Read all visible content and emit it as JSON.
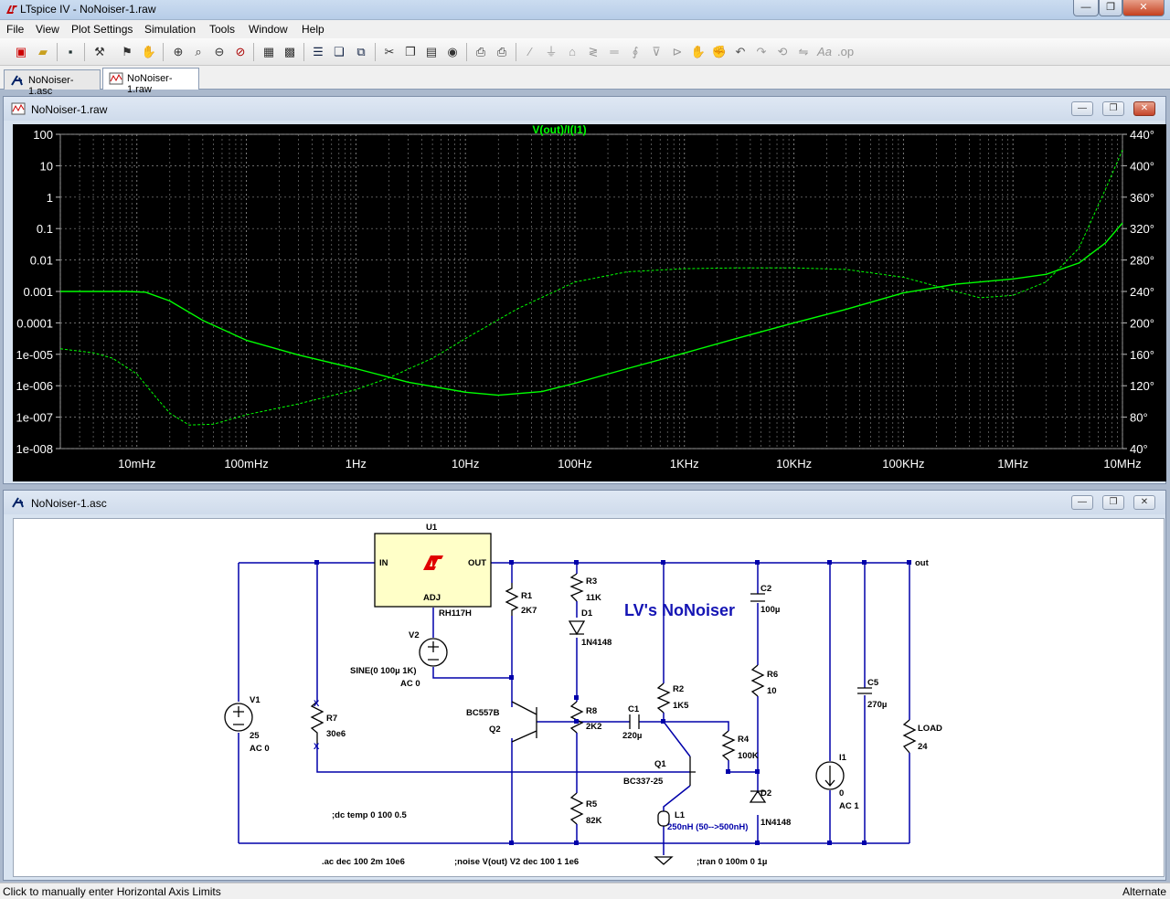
{
  "window": {
    "title": "LTspice IV - NoNoiser-1.raw"
  },
  "menu": [
    "File",
    "View",
    "Plot Settings",
    "Simulation",
    "Tools",
    "Window",
    "Help"
  ],
  "tabs": [
    {
      "label": "NoNoiser-1.asc"
    },
    {
      "label": "NoNoiser-1.raw"
    }
  ],
  "plot_window": {
    "title": "NoNoiser-1.raw",
    "trace_label": "V(out)/I(I1)",
    "colors": {
      "background": "#000000",
      "trace": "#00ff00",
      "axis_text": "#ffffff"
    }
  },
  "chart_data": {
    "type": "line",
    "title": "V(out)/I(I1)",
    "x_scale": "log",
    "xlim": [
      0.002,
      10000000
    ],
    "x_ticks": [
      {
        "v": 0.01,
        "label": "10mHz"
      },
      {
        "v": 0.1,
        "label": "100mHz"
      },
      {
        "v": 1,
        "label": "1Hz"
      },
      {
        "v": 10,
        "label": "10Hz"
      },
      {
        "v": 100,
        "label": "100Hz"
      },
      {
        "v": 1000,
        "label": "1KHz"
      },
      {
        "v": 10000,
        "label": "10KHz"
      },
      {
        "v": 100000,
        "label": "100KHz"
      },
      {
        "v": 1000000,
        "label": "1MHz"
      },
      {
        "v": 10000000,
        "label": "10MHz"
      }
    ],
    "y_scale": "log",
    "ylim": [
      1e-08,
      100
    ],
    "y_ticks": [
      {
        "v": 100,
        "label": "100"
      },
      {
        "v": 10,
        "label": "10"
      },
      {
        "v": 1,
        "label": "1"
      },
      {
        "v": 0.1,
        "label": "0.1"
      },
      {
        "v": 0.01,
        "label": "0.01"
      },
      {
        "v": 0.001,
        "label": "0.001"
      },
      {
        "v": 0.0001,
        "label": "0.0001"
      },
      {
        "v": 1e-05,
        "label": "1e-005"
      },
      {
        "v": 1e-06,
        "label": "1e-006"
      },
      {
        "v": 1e-07,
        "label": "1e-007"
      },
      {
        "v": 1e-08,
        "label": "1e-008"
      }
    ],
    "y2lim": [
      40,
      440
    ],
    "y2_ticks": [
      {
        "v": 440,
        "label": "440°"
      },
      {
        "v": 400,
        "label": "400°"
      },
      {
        "v": 360,
        "label": "360°"
      },
      {
        "v": 320,
        "label": "320°"
      },
      {
        "v": 280,
        "label": "280°"
      },
      {
        "v": 240,
        "label": "240°"
      },
      {
        "v": 200,
        "label": "200°"
      },
      {
        "v": 160,
        "label": "160°"
      },
      {
        "v": 120,
        "label": "120°"
      },
      {
        "v": 80,
        "label": "80°"
      },
      {
        "v": 40,
        "label": "40°"
      }
    ],
    "grid": true,
    "series": [
      {
        "name": "V(out)/I(I1)",
        "style": "solid",
        "axis": "left",
        "x": [
          0.002,
          0.004,
          0.008,
          0.012,
          0.02,
          0.04,
          0.1,
          0.3,
          1,
          3,
          10,
          20,
          50,
          100,
          300,
          1000,
          3000,
          10000,
          30000,
          100000,
          300000,
          1000000,
          2000000,
          4000000,
          7000000,
          10000000
        ],
        "y": [
          0.001,
          0.001,
          0.001,
          0.00095,
          0.0005,
          0.00012,
          2.8e-05,
          9.5e-06,
          3.5e-06,
          1.3e-06,
          6.2e-07,
          5e-07,
          6.5e-07,
          1.2e-06,
          3.5e-06,
          1.1e-05,
          3.2e-05,
          0.0001,
          0.00027,
          0.0009,
          0.0017,
          0.0025,
          0.0035,
          0.008,
          0.035,
          0.15
        ]
      },
      {
        "name": "phase",
        "style": "dashed",
        "axis": "right",
        "x": [
          0.002,
          0.004,
          0.006,
          0.01,
          0.015,
          0.02,
          0.03,
          0.05,
          0.1,
          0.3,
          1,
          2,
          5,
          10,
          30,
          100,
          300,
          1000,
          3000,
          10000,
          30000,
          100000,
          300000,
          500000,
          1000000,
          2000000,
          4000000,
          7000000,
          10000000
        ],
        "y": [
          167,
          162,
          155,
          135,
          105,
          85,
          70,
          71,
          83,
          97,
          115,
          130,
          155,
          180,
          218,
          252,
          265,
          269,
          270,
          270,
          268,
          258,
          240,
          232,
          235,
          252,
          295,
          370,
          420
        ]
      }
    ]
  },
  "schematic_window": {
    "title": "NoNoiser-1.asc",
    "banner": "LV's NoNoiser",
    "labels": {
      "u1": "U1",
      "u1_in": "IN",
      "u1_out": "OUT",
      "u1_adj": "ADJ",
      "u1_part": "RH117H",
      "v1": "V1",
      "v1_val": "25",
      "v1_ac": "AC 0",
      "v2": "V2",
      "v2_val": "SINE(0 100µ 1K)",
      "v2_ac": "AC 0",
      "r1": "R1",
      "r1_val": "2K7",
      "r2": "R2",
      "r2_val": "1K5",
      "r3": "R3",
      "r3_val": "11K",
      "r4": "R4",
      "r4_val": "100K",
      "r5": "R5",
      "r5_val": "82K",
      "r6": "R6",
      "r6_val": "10",
      "r7": "R7",
      "r7_val": "30e6",
      "r8": "R8",
      "r8_val": "2K2",
      "c1": "C1",
      "c1_val": "220µ",
      "c2": "C2",
      "c2_val": "100µ",
      "c5": "C5",
      "c5_val": "270µ",
      "d1": "D1",
      "d1_val": "1N4148",
      "d2": "D2",
      "d2_val": "1N4148",
      "q1": "Q1",
      "q1_val": "BC337-25",
      "q2": "Q2",
      "q2_val": "BC557B",
      "l1": "L1",
      "l1_val": "250nH (50-->500nH)",
      "i1": "I1",
      "i1_val": "0",
      "i1_ac": "AC 1",
      "load": "LOAD",
      "load_val": "24",
      "net_out": "out",
      "x_mark": "X"
    },
    "directives": [
      ";dc temp 0 100 0.5",
      ".ac dec 100 2m 10e6",
      ";noise V(out) V2 dec 100 1 1e6",
      ";tran 0 100m 0 1µ"
    ],
    "colors": {
      "wire": "#0000aa",
      "text": "#000000",
      "banner": "#1414b4",
      "ic_fill": "#ffffc8",
      "logo": "#e00000"
    }
  },
  "status": {
    "left": "Click to manually enter Horizontal Axis Limits",
    "right": "Alternate"
  }
}
